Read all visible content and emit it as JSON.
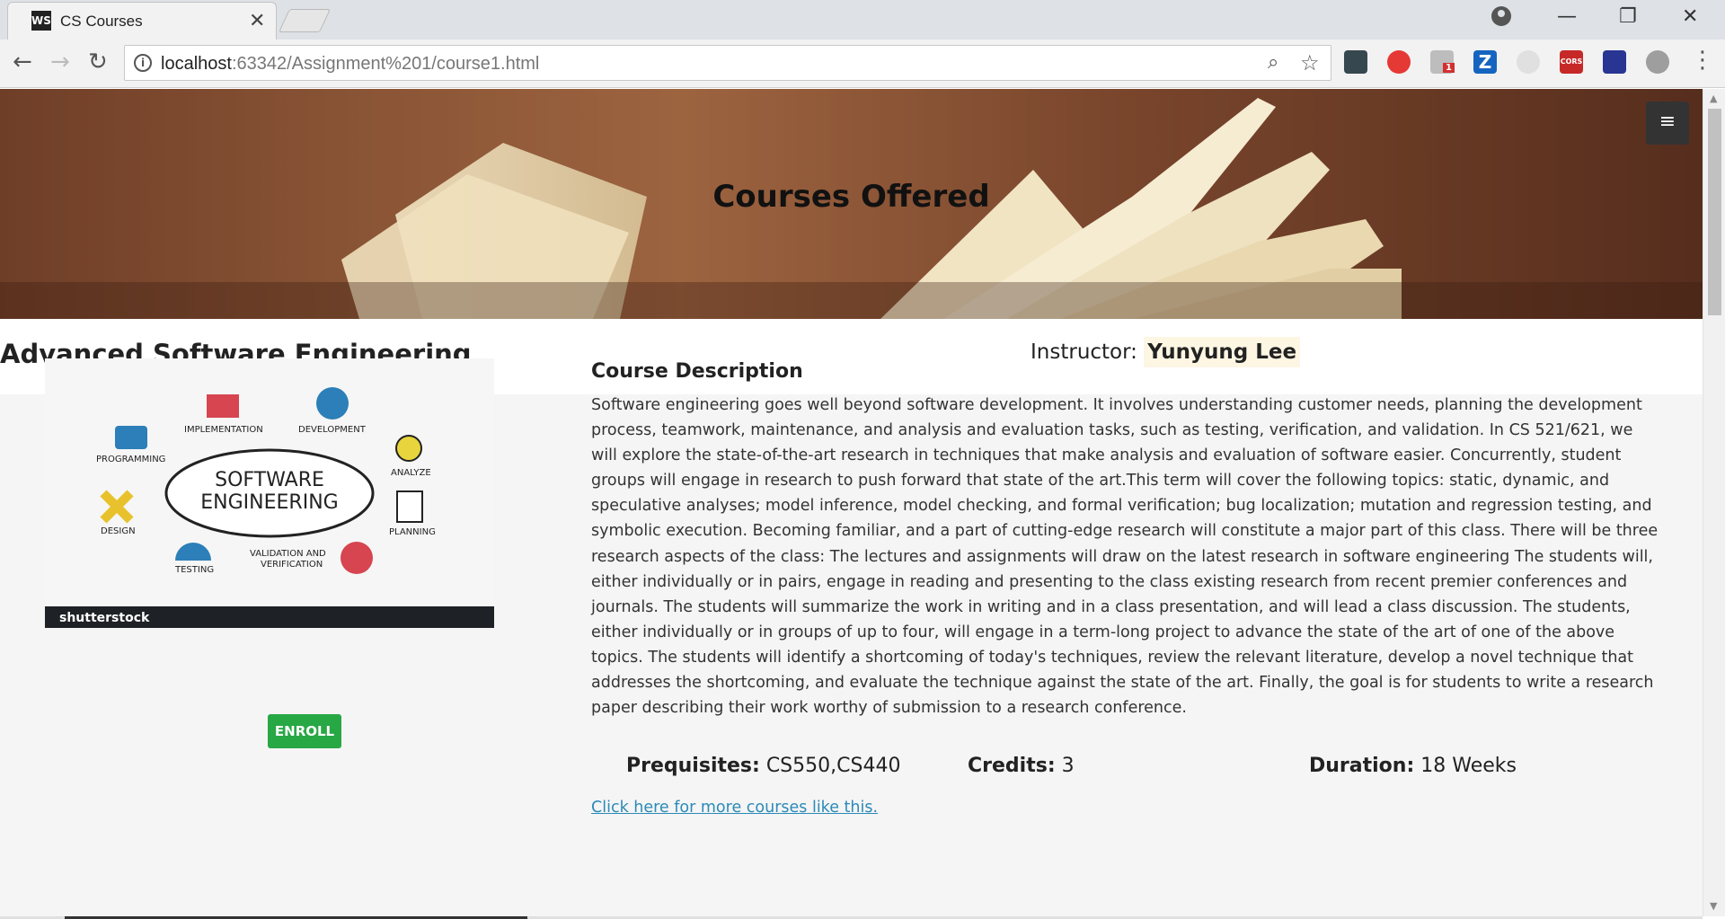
{
  "browser": {
    "tab_title": "CS Courses",
    "favicon_text": "WS",
    "tab_close": "✕",
    "url_host": "localhost",
    "url_rest": ":63342/Assignment%201/course1.html",
    "extension_badge": "1",
    "extension_z": "Z",
    "extension_cors": "CORS"
  },
  "page": {
    "hero_title": "Courses Offered",
    "course_title": "Advanced Software Engineering",
    "instructor_label": "Instructor:",
    "instructor_name": "Yunyung Lee",
    "enroll_label": "ENROLL",
    "image_watermark": "shutterstock",
    "image_diagram": {
      "center_line1": "SOFTWARE",
      "center_line2": "ENGINEERING",
      "nodes": [
        "IMPLEMENTATION",
        "DEVELOPMENT",
        "PROGRAMMING",
        "ANALYZE",
        "DESIGN",
        "PLANNING",
        "TESTING",
        "VALIDATION AND",
        "VERIFICATION"
      ]
    },
    "description_heading": "Course Description",
    "description": "Software engineering goes well beyond software development. It involves understanding customer needs, planning the development process, teamwork, maintenance, and analysis and evaluation tasks, such as testing, verification, and validation. In CS 521/621, we will explore the state-of-the-art research in techniques that make analysis and evaluation of software easier. Concurrently, student groups will engage in research to push forward that state of the art.This term will cover the following topics: static, dynamic, and speculative analyses; model inference, model checking, and formal verification; bug localization; mutation and regression testing, and symbolic execution. Becoming familiar, and a part of cutting-edge research will constitute a major part of this class. There will be three research aspects of the class: The lectures and assignments will draw on the latest research in software engineering The students will, either individually or in pairs, engage in reading and presenting to the class existing research from recent premier conferences and journals. The students will summarize the work in writing and in a class presentation, and will lead a class discussion. The students, either individually or in groups of up to four, will engage in a term-long project to advance the state of the art of one of the above topics. The students will identify a shortcoming of today's techniques, review the relevant literature, develop a novel technique that addresses the shortcoming, and evaluate the technique against the state of the art. Finally, the goal is for students to write a research paper describing their work worthy of submission to a research conference.",
    "prereq_label": "Prequisites:",
    "prereq_value": "CS550,CS440",
    "credits_label": "Credits:",
    "credits_value": "3",
    "duration_label": "Duration:",
    "duration_value": "18 Weeks",
    "more_link": "Click here for more courses like this."
  },
  "colors": {
    "enroll_bg": "#28a745",
    "link": "#2b8ab8",
    "instructor_highlight": "#fdf6e3",
    "hamburger_bg": "#333333"
  },
  "icons": [
    "back-icon",
    "forward-icon",
    "reload-icon",
    "info-icon",
    "zoom-icon",
    "star-icon",
    "hamburger-icon",
    "user-icon",
    "minimize-icon",
    "restore-icon",
    "close-icon",
    "menu-dots-icon"
  ]
}
